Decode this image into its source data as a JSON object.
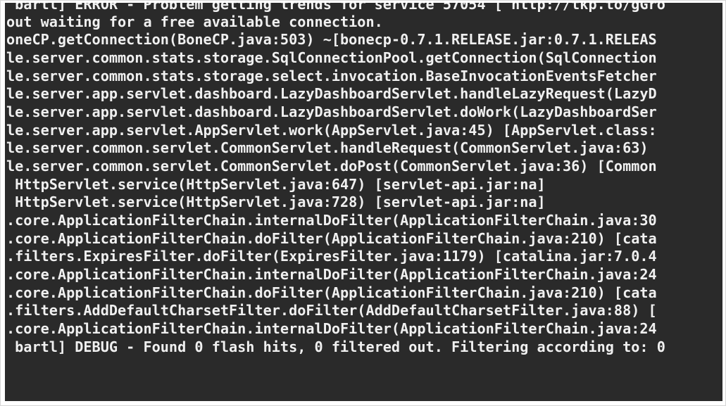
{
  "terminal": {
    "lines": [
      " bartl] ERROR - Problem getting trends for service 57054 [ http://tkp.to/gGro",
      "out waiting for a free available connection.",
      "oneCP.getConnection(BoneCP.java:503) ~[bonecp-0.7.1.RELEASE.jar:0.7.1.RELEAS",
      "le.server.common.stats.storage.SqlConnectionPool.getConnection(SqlConnection",
      "le.server.common.stats.storage.select.invocation.BaseInvocationEventsFetcher",
      "le.server.app.servlet.dashboard.LazyDashboardServlet.handleLazyRequest(LazyD",
      "le.server.app.servlet.dashboard.LazyDashboardServlet.doWork(LazyDashboardSer",
      "le.server.app.servlet.AppServlet.work(AppServlet.java:45) [AppServlet.class:",
      "le.server.common.servlet.CommonServlet.handleRequest(CommonServlet.java:63)",
      "le.server.common.servlet.CommonServlet.doPost(CommonServlet.java:36) [Common",
      " HttpServlet.service(HttpServlet.java:647) [servlet-api.jar:na]",
      " HttpServlet.service(HttpServlet.java:728) [servlet-api.jar:na]",
      ".core.ApplicationFilterChain.internalDoFilter(ApplicationFilterChain.java:30",
      ".core.ApplicationFilterChain.doFilter(ApplicationFilterChain.java:210) [cata",
      ".filters.ExpiresFilter.doFilter(ExpiresFilter.java:1179) [catalina.jar:7.0.4",
      ".core.ApplicationFilterChain.internalDoFilter(ApplicationFilterChain.java:24",
      ".core.ApplicationFilterChain.doFilter(ApplicationFilterChain.java:210) [cata",
      ".filters.AddDefaultCharsetFilter.doFilter(AddDefaultCharsetFilter.java:88) [",
      ".core.ApplicationFilterChain.internalDoFilter(ApplicationFilterChain.java:24",
      " bartl] DEBUG - Found 0 flash hits, 0 filtered out. Filtering according to: 0"
    ]
  },
  "colors": {
    "background": "#2a2a2a",
    "text": "#f0f0f0"
  }
}
